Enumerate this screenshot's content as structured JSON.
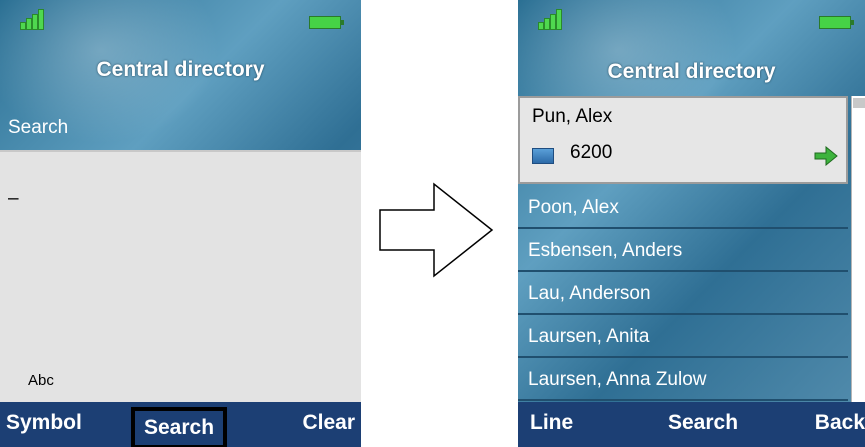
{
  "left": {
    "title": "Central directory",
    "field_label": "Search",
    "input_value": "–",
    "input_mode": "Abc",
    "softkeys": {
      "left": "Symbol",
      "center": "Search",
      "right": "Clear"
    }
  },
  "right": {
    "title": "Central directory",
    "selected": {
      "name": "Pun, Alex",
      "extension": "6200"
    },
    "contacts": [
      "Poon, Alex",
      "Esbensen, Anders",
      "Lau, Anderson",
      "Laursen, Anita",
      "Laursen, Anna Zulow"
    ],
    "softkeys": {
      "left": "Line",
      "center": "Search",
      "right": "Back"
    }
  },
  "icons": {
    "signal": "signal-strength-icon",
    "battery": "battery-icon",
    "phone": "desk-phone-icon",
    "call": "green-arrow-icon",
    "transition": "transition-arrow-icon"
  }
}
